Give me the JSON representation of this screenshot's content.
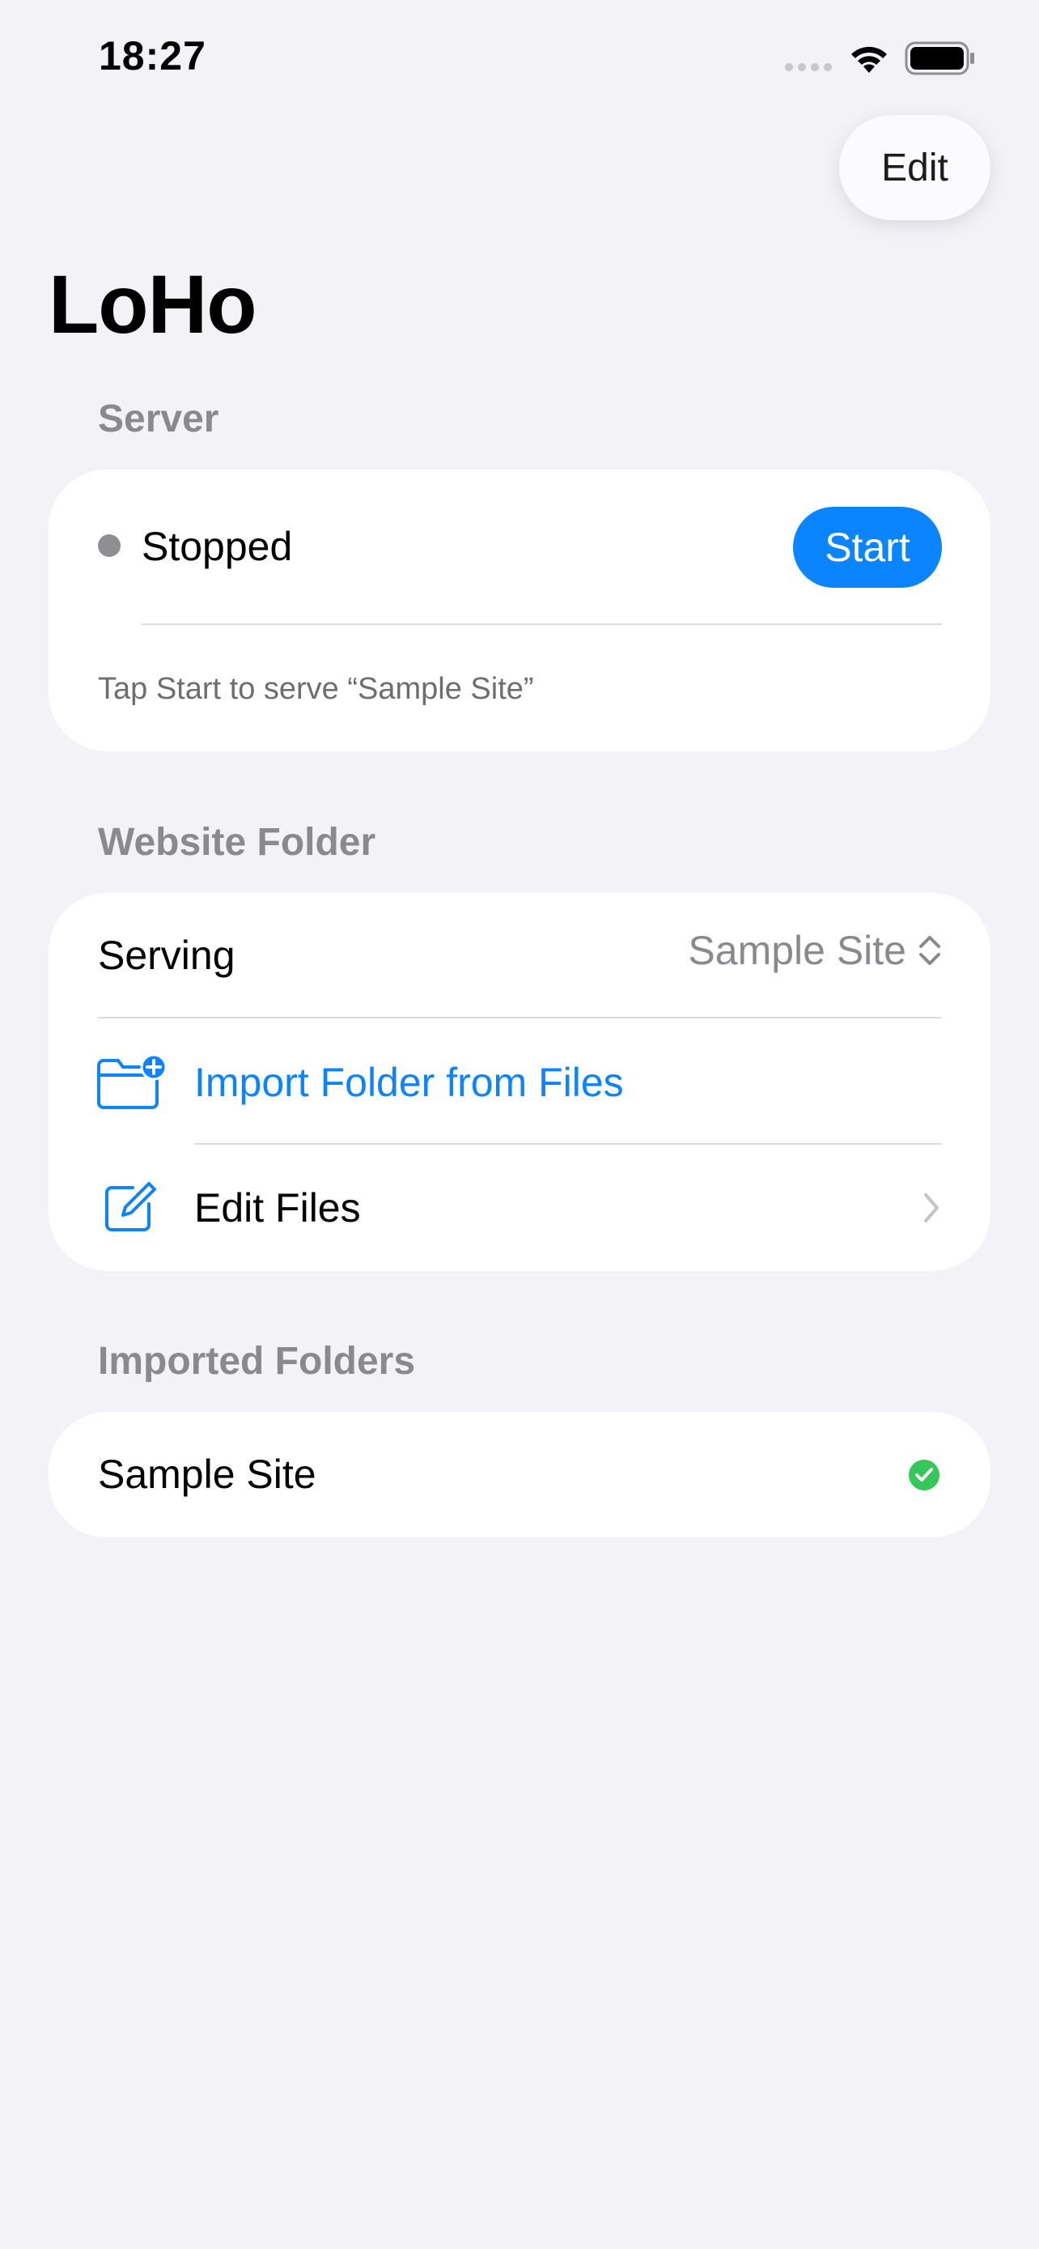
{
  "status_bar": {
    "time": "18:27"
  },
  "nav": {
    "edit_label": "Edit",
    "title": "LoHo"
  },
  "server": {
    "header": "Server",
    "status": "Stopped",
    "start_label": "Start",
    "footnote": "Tap Start to serve “Sample Site”",
    "status_color": "#8e8e93"
  },
  "website_folder": {
    "header": "Website Folder",
    "serving_label": "Serving",
    "serving_value": "Sample Site",
    "import_label": "Import Folder from Files",
    "edit_files_label": "Edit Files",
    "icons": [
      "folder-plus-icon",
      "square-pencil-icon",
      "chevron-right-icon",
      "chevron-up-down-icon"
    ]
  },
  "imported_folders": {
    "header": "Imported Folders",
    "items": [
      {
        "name": "Sample Site",
        "selected": true
      }
    ]
  },
  "colors": {
    "accent": "#0a84ff",
    "success": "#34c759",
    "background": "#f2f2f7"
  }
}
